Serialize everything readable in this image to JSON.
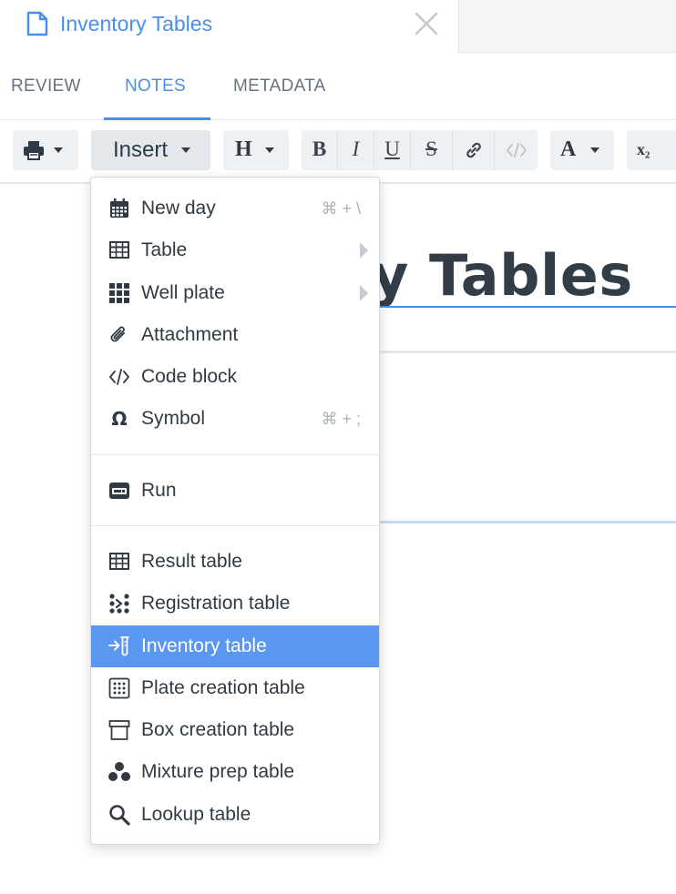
{
  "tab": {
    "title": "Inventory Tables"
  },
  "subtabs": {
    "review": "REVIEW",
    "notes": "NOTES",
    "metadata": "METADATA",
    "active": "NOTES"
  },
  "toolbar": {
    "insert_label": "Insert",
    "heading_label": "H",
    "bold_label": "B",
    "italic_label": "I",
    "underline_label": "U",
    "strike_label": "S",
    "font_color_label": "A",
    "subscript_label": "x₂"
  },
  "document": {
    "heading_visible": "y Tables"
  },
  "menu": {
    "items": [
      {
        "label": "New day",
        "icon": "calendar-icon",
        "shortcut": "⌘ + \\"
      },
      {
        "label": "Table",
        "icon": "table-icon",
        "submenu": true
      },
      {
        "label": "Well plate",
        "icon": "grid-dots-icon",
        "submenu": true
      },
      {
        "label": "Attachment",
        "icon": "paperclip-icon"
      },
      {
        "label": "Code block",
        "icon": "code-icon"
      },
      {
        "label": "Symbol",
        "icon": "omega-icon",
        "shortcut": "⌘ + ;"
      },
      {
        "label": "Run",
        "icon": "run-icon"
      },
      {
        "label": "Result table",
        "icon": "result-table-icon"
      },
      {
        "label": "Registration table",
        "icon": "registration-icon"
      },
      {
        "label": "Inventory table",
        "icon": "inventory-icon",
        "highlighted": true
      },
      {
        "label": "Plate creation table",
        "icon": "plate-icon"
      },
      {
        "label": "Box creation table",
        "icon": "box-icon"
      },
      {
        "label": "Mixture prep table",
        "icon": "mixture-icon"
      },
      {
        "label": "Lookup table",
        "icon": "magnifier-icon"
      }
    ]
  },
  "colors": {
    "accent": "#4a8ee9",
    "highlight": "#5b97f0",
    "text": "#2f3a45",
    "muted": "#66737f"
  }
}
